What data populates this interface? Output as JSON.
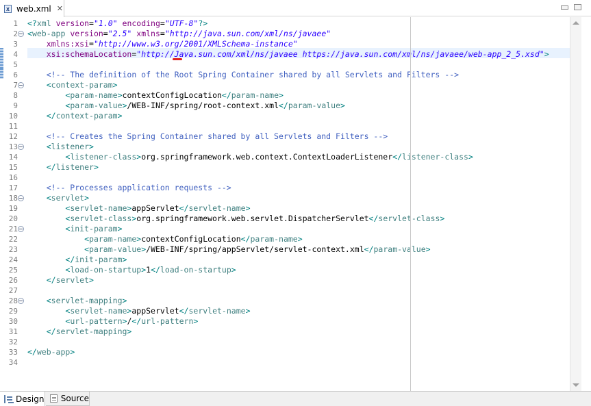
{
  "tab": {
    "title": "web.xml",
    "file_icon": "xml-file-icon",
    "close_glyph": "✕"
  },
  "editor": {
    "line_numbers": [
      "1",
      "2",
      "3",
      "4",
      "5",
      "6",
      "7",
      "8",
      "9",
      "10",
      "11",
      "12",
      "13",
      "14",
      "15",
      "16",
      "17",
      "18",
      "19",
      "20",
      "21",
      "22",
      "23",
      "24",
      "25",
      "26",
      "27",
      "28",
      "29",
      "30",
      "31",
      "32",
      "33",
      "34"
    ],
    "fold_lines": [
      2,
      7,
      13,
      18,
      21,
      28
    ],
    "lines": [
      [
        [
          "pi",
          "<?"
        ],
        [
          "tag",
          "xml"
        ],
        [
          "attr",
          " version"
        ],
        [
          "txt",
          "="
        ],
        [
          "val",
          "\"1.0\""
        ],
        [
          "attr",
          " encoding"
        ],
        [
          "txt",
          "="
        ],
        [
          "val",
          "\"UTF-8\""
        ],
        [
          "pi",
          "?>"
        ]
      ],
      [
        [
          "bracket",
          "<"
        ],
        [
          "tag",
          "web-app"
        ],
        [
          "attr",
          " version"
        ],
        [
          "txt",
          "="
        ],
        [
          "val",
          "\"2.5\""
        ],
        [
          "attr",
          " xmlns"
        ],
        [
          "txt",
          "="
        ],
        [
          "val",
          "\"http://java.sun.com/xml/ns/javaee\""
        ]
      ],
      [
        [
          "attr",
          "    xmlns:xsi"
        ],
        [
          "txt",
          "="
        ],
        [
          "val",
          "\"http://www.w3.org/2001/XMLSchema-instance\""
        ]
      ],
      [
        [
          "attr",
          "    xsi:schemaLocation"
        ],
        [
          "txt",
          "="
        ],
        [
          "val",
          "\"http://Java.sun.com/xml/ns/javaee https://java.sun.com/xml/ns/javaee/web-app_2_5.xsd\""
        ],
        [
          "bracket",
          ">"
        ]
      ],
      [],
      [
        [
          "com",
          "    <!-- The definition of the Root Spring Container shared by all Servlets and Filters -->"
        ]
      ],
      [
        [
          "txt",
          "    "
        ],
        [
          "bracket",
          "<"
        ],
        [
          "tag",
          "context-param"
        ],
        [
          "bracket",
          ">"
        ]
      ],
      [
        [
          "txt",
          "        "
        ],
        [
          "bracket",
          "<"
        ],
        [
          "tag",
          "param-name"
        ],
        [
          "bracket",
          ">"
        ],
        [
          "txt",
          "contextConfigLocation"
        ],
        [
          "bracket",
          "</"
        ],
        [
          "tag",
          "param-name"
        ],
        [
          "bracket",
          ">"
        ]
      ],
      [
        [
          "txt",
          "        "
        ],
        [
          "bracket",
          "<"
        ],
        [
          "tag",
          "param-value"
        ],
        [
          "bracket",
          ">"
        ],
        [
          "txt",
          "/WEB-INF/spring/root-context.xml"
        ],
        [
          "bracket",
          "</"
        ],
        [
          "tag",
          "param-value"
        ],
        [
          "bracket",
          ">"
        ]
      ],
      [
        [
          "txt",
          "    "
        ],
        [
          "bracket",
          "</"
        ],
        [
          "tag",
          "context-param"
        ],
        [
          "bracket",
          ">"
        ]
      ],
      [],
      [
        [
          "com",
          "    <!-- Creates the Spring Container shared by all Servlets and Filters -->"
        ]
      ],
      [
        [
          "txt",
          "    "
        ],
        [
          "bracket",
          "<"
        ],
        [
          "tag",
          "listener"
        ],
        [
          "bracket",
          ">"
        ]
      ],
      [
        [
          "txt",
          "        "
        ],
        [
          "bracket",
          "<"
        ],
        [
          "tag",
          "listener-class"
        ],
        [
          "bracket",
          ">"
        ],
        [
          "txt",
          "org.springframework.web.context.ContextLoaderListener"
        ],
        [
          "bracket",
          "</"
        ],
        [
          "tag",
          "listener-class"
        ],
        [
          "bracket",
          ">"
        ]
      ],
      [
        [
          "txt",
          "    "
        ],
        [
          "bracket",
          "</"
        ],
        [
          "tag",
          "listener"
        ],
        [
          "bracket",
          ">"
        ]
      ],
      [],
      [
        [
          "com",
          "    <!-- Processes application requests -->"
        ]
      ],
      [
        [
          "txt",
          "    "
        ],
        [
          "bracket",
          "<"
        ],
        [
          "tag",
          "servlet"
        ],
        [
          "bracket",
          ">"
        ]
      ],
      [
        [
          "txt",
          "        "
        ],
        [
          "bracket",
          "<"
        ],
        [
          "tag",
          "servlet-name"
        ],
        [
          "bracket",
          ">"
        ],
        [
          "txt",
          "appServlet"
        ],
        [
          "bracket",
          "</"
        ],
        [
          "tag",
          "servlet-name"
        ],
        [
          "bracket",
          ">"
        ]
      ],
      [
        [
          "txt",
          "        "
        ],
        [
          "bracket",
          "<"
        ],
        [
          "tag",
          "servlet-class"
        ],
        [
          "bracket",
          ">"
        ],
        [
          "txt",
          "org.springframework.web.servlet.DispatcherServlet"
        ],
        [
          "bracket",
          "</"
        ],
        [
          "tag",
          "servlet-class"
        ],
        [
          "bracket",
          ">"
        ]
      ],
      [
        [
          "txt",
          "        "
        ],
        [
          "bracket",
          "<"
        ],
        [
          "tag",
          "init-param"
        ],
        [
          "bracket",
          ">"
        ]
      ],
      [
        [
          "txt",
          "            "
        ],
        [
          "bracket",
          "<"
        ],
        [
          "tag",
          "param-name"
        ],
        [
          "bracket",
          ">"
        ],
        [
          "txt",
          "contextConfigLocation"
        ],
        [
          "bracket",
          "</"
        ],
        [
          "tag",
          "param-name"
        ],
        [
          "bracket",
          ">"
        ]
      ],
      [
        [
          "txt",
          "            "
        ],
        [
          "bracket",
          "<"
        ],
        [
          "tag",
          "param-value"
        ],
        [
          "bracket",
          ">"
        ],
        [
          "txt",
          "/WEB-INF/spring/appServlet/servlet-context.xml"
        ],
        [
          "bracket",
          "</"
        ],
        [
          "tag",
          "param-value"
        ],
        [
          "bracket",
          ">"
        ]
      ],
      [
        [
          "txt",
          "        "
        ],
        [
          "bracket",
          "</"
        ],
        [
          "tag",
          "init-param"
        ],
        [
          "bracket",
          ">"
        ]
      ],
      [
        [
          "txt",
          "        "
        ],
        [
          "bracket",
          "<"
        ],
        [
          "tag",
          "load-on-startup"
        ],
        [
          "bracket",
          ">"
        ],
        [
          "txt",
          "1"
        ],
        [
          "bracket",
          "</"
        ],
        [
          "tag",
          "load-on-startup"
        ],
        [
          "bracket",
          ">"
        ]
      ],
      [
        [
          "txt",
          "    "
        ],
        [
          "bracket",
          "</"
        ],
        [
          "tag",
          "servlet"
        ],
        [
          "bracket",
          ">"
        ]
      ],
      [],
      [
        [
          "txt",
          "    "
        ],
        [
          "bracket",
          "<"
        ],
        [
          "tag",
          "servlet-mapping"
        ],
        [
          "bracket",
          ">"
        ]
      ],
      [
        [
          "txt",
          "        "
        ],
        [
          "bracket",
          "<"
        ],
        [
          "tag",
          "servlet-name"
        ],
        [
          "bracket",
          ">"
        ],
        [
          "txt",
          "appServlet"
        ],
        [
          "bracket",
          "</"
        ],
        [
          "tag",
          "servlet-name"
        ],
        [
          "bracket",
          ">"
        ]
      ],
      [
        [
          "txt",
          "        "
        ],
        [
          "bracket",
          "<"
        ],
        [
          "tag",
          "url-pattern"
        ],
        [
          "bracket",
          ">"
        ],
        [
          "txt",
          "/"
        ],
        [
          "bracket",
          "</"
        ],
        [
          "tag",
          "url-pattern"
        ],
        [
          "bracket",
          ">"
        ]
      ],
      [
        [
          "txt",
          "    "
        ],
        [
          "bracket",
          "</"
        ],
        [
          "tag",
          "servlet-mapping"
        ],
        [
          "bracket",
          ">"
        ]
      ],
      [],
      [
        [
          "bracket",
          "</"
        ],
        [
          "tag",
          "web-app"
        ],
        [
          "bracket",
          ">"
        ]
      ],
      []
    ]
  },
  "bottom_tabs": [
    {
      "label": "Design",
      "icon": "design-icon"
    },
    {
      "label": "Source",
      "icon": "source-icon"
    }
  ],
  "colors": {
    "tag": "#3f7f7f",
    "attr": "#7f007f",
    "value": "#2a00ff",
    "comment": "#3f5fbf",
    "current_line": "#e8f2fe"
  }
}
